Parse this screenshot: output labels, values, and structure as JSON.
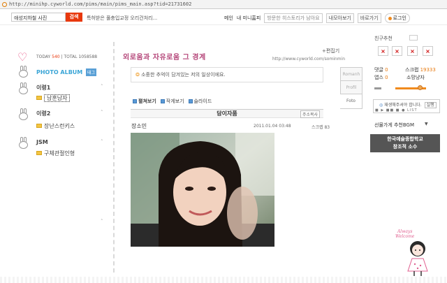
{
  "browser": {
    "url": "http://minihp.cyworld.com/pims/main/pims_main.asp?tid=21731602"
  },
  "top": {
    "search_value": "애성지하철 사진",
    "search_button": "검색",
    "news_text": "특허받은 풀충입교정 오리건처리...",
    "nav": {
      "main": "메인",
      "mini_home": "내 미니홈피",
      "history_box": "방문한 히스토리가 남아요",
      "my_view": "내모아보기",
      "shortcut": "바로가기",
      "logout": "로그인"
    }
  },
  "left": {
    "today_label": "TODAY",
    "today_value": "540",
    "total_label": "TOTAL",
    "total_value": "1058588",
    "album_title": "PHOTO ALBUM",
    "album_tag": "태그",
    "groups": [
      {
        "name": "이령1",
        "items": [
          "남훈남자"
        ]
      },
      {
        "name": "이령2",
        "items": [
          "장난스런키스"
        ]
      },
      {
        "name": "JSM",
        "items": [
          "구체관절인형"
        ]
      }
    ],
    "collapse_symbol": "˄"
  },
  "center": {
    "title": "외로움과 자유로움 그 경계",
    "edit_link": "+편집기",
    "home_url": "http://www.cyworld.com/sominmin",
    "quote": "소중한 추억이 담겨있는 저의 일상이에요.",
    "view_options": [
      "펼쳐보기",
      "작게보기",
      "슬라이드"
    ],
    "photo_title": "담이자품",
    "copy_addr": "주소복사",
    "author": "장소민",
    "timestamp": "2011.01.04 03:48",
    "scrap_label": "스크랩 83"
  },
  "tabs": [
    "Romanh",
    "Profil",
    "Foto"
  ],
  "right": {
    "friends_label": "친구추천",
    "comments_label": "댓글",
    "comments_value": "0",
    "scrap_label": "스크랩",
    "scrap_value": "19333",
    "emblem_label": "앱스",
    "emblem_value": "0",
    "stats_name": "소망냥자",
    "player_text": "재생해주셔야 합니다.",
    "player_btn": "실행",
    "player_ctrl": "■ ▶ ■■ ■ ● LIST",
    "bgm_label": "선물가게 추천BGM",
    "bgm_arrow": "▼",
    "banner_line1": "한국예술종합학교",
    "banner_line2": "창조적 소수"
  },
  "deco": {
    "line1": "Always",
    "line2": "Welcome"
  },
  "colors": {
    "accent": "#e8380d",
    "pink": "#b5477a",
    "blue": "#3aa5d6",
    "orange": "#f08a1c"
  }
}
